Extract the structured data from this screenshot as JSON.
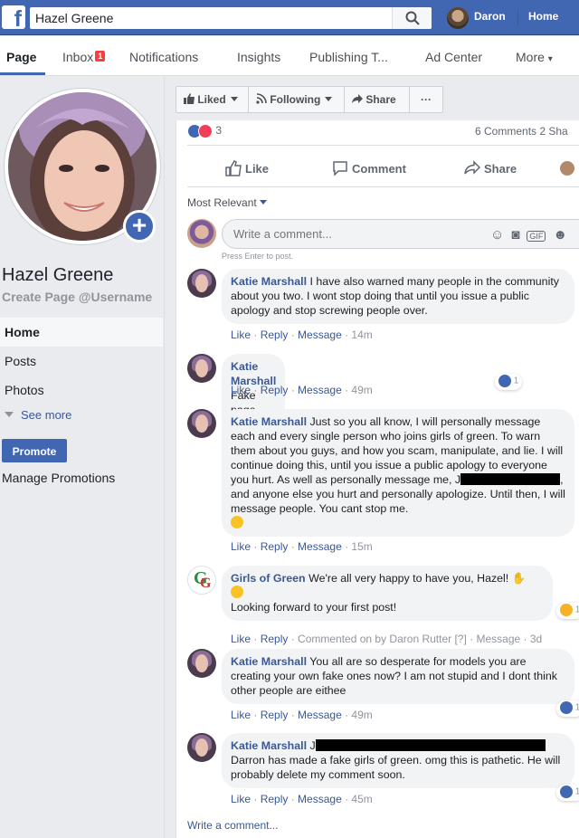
{
  "topbar": {
    "logo": "f",
    "search_value": "Hazel Greene",
    "user_name": "Daron",
    "home_label": "Home"
  },
  "tabs": {
    "page": "Page",
    "inbox": "Inbox",
    "inbox_badge": "1",
    "notifications": "Notifications",
    "insights": "Insights",
    "publishing": "Publishing T...",
    "ad_center": "Ad Center",
    "more": "More",
    "more_caret": "▾"
  },
  "sidebar": {
    "page_name": "Hazel Greene",
    "page_handle": "Create Page @Username",
    "add_photo": "+",
    "nav": [
      "Home",
      "Posts",
      "Photos"
    ],
    "see_more": "See more",
    "promote": "Promote",
    "manage_promotions": "Manage Promotions"
  },
  "actions": {
    "liked": "Liked",
    "following": "Following",
    "share": "Share",
    "more": "···"
  },
  "post": {
    "reaction_count": "3",
    "comments_shares": "6 Comments  2 Sha",
    "like": "Like",
    "comment": "Comment",
    "share": "Share",
    "sort": "Most Relevant",
    "composer_placeholder": "Write a comment...",
    "enter_hint": "Press Enter to post.",
    "write_comment": "Write a comment..."
  },
  "comments": [
    {
      "author": "Katie Marshall",
      "text": "I have also warned many people in the community about you two. I wont stop doing that until you issue a public apology and stop screwing people over.",
      "time": "14m"
    },
    {
      "author": "Katie Marshall",
      "text": "Fake page. The picture isnt even real.",
      "time": "49m",
      "reactions": "1"
    },
    {
      "author": "Katie Marshall",
      "text_a": "Just so you all know, I will personally message each and every single person who joins girls of green. To warn them about you guys, and how you scam, manipulate, and lie. I will continue doing this, until you issue a public apology to everyone you hurt. As well as personally message me, J",
      "text_b": ", and anyone else you hurt and personally apologize. Until then, I will message people. You cant stop me.",
      "time": "15m"
    },
    {
      "author": "Girls of Green",
      "text_a": "We're all very happy to have you, Hazel!",
      "text_b": "Looking forward to your first post!",
      "commented_on": "Commented on by Daron Rutter [?]",
      "time": "3d",
      "reactions": "1"
    },
    {
      "author": "Katie Marshall",
      "text": "You all are so desperate for models you are creating your own fake ones now? I am not stupid and I dont think other people are eithee",
      "time": "49m",
      "reactions": "1"
    },
    {
      "author": "Katie Marshall",
      "text_a": "J",
      "text_b": "Darron has made a fake girls of green. omg this is pathetic. He will probably delete my comment soon.",
      "time": "45m",
      "reactions": "1"
    }
  ],
  "comment_actions": {
    "like": "Like",
    "reply": "Reply",
    "message": "Message",
    "sep": " · "
  },
  "colors": {
    "brand": "#4267b2",
    "link": "#385898",
    "badge": "#fa3e3e"
  }
}
